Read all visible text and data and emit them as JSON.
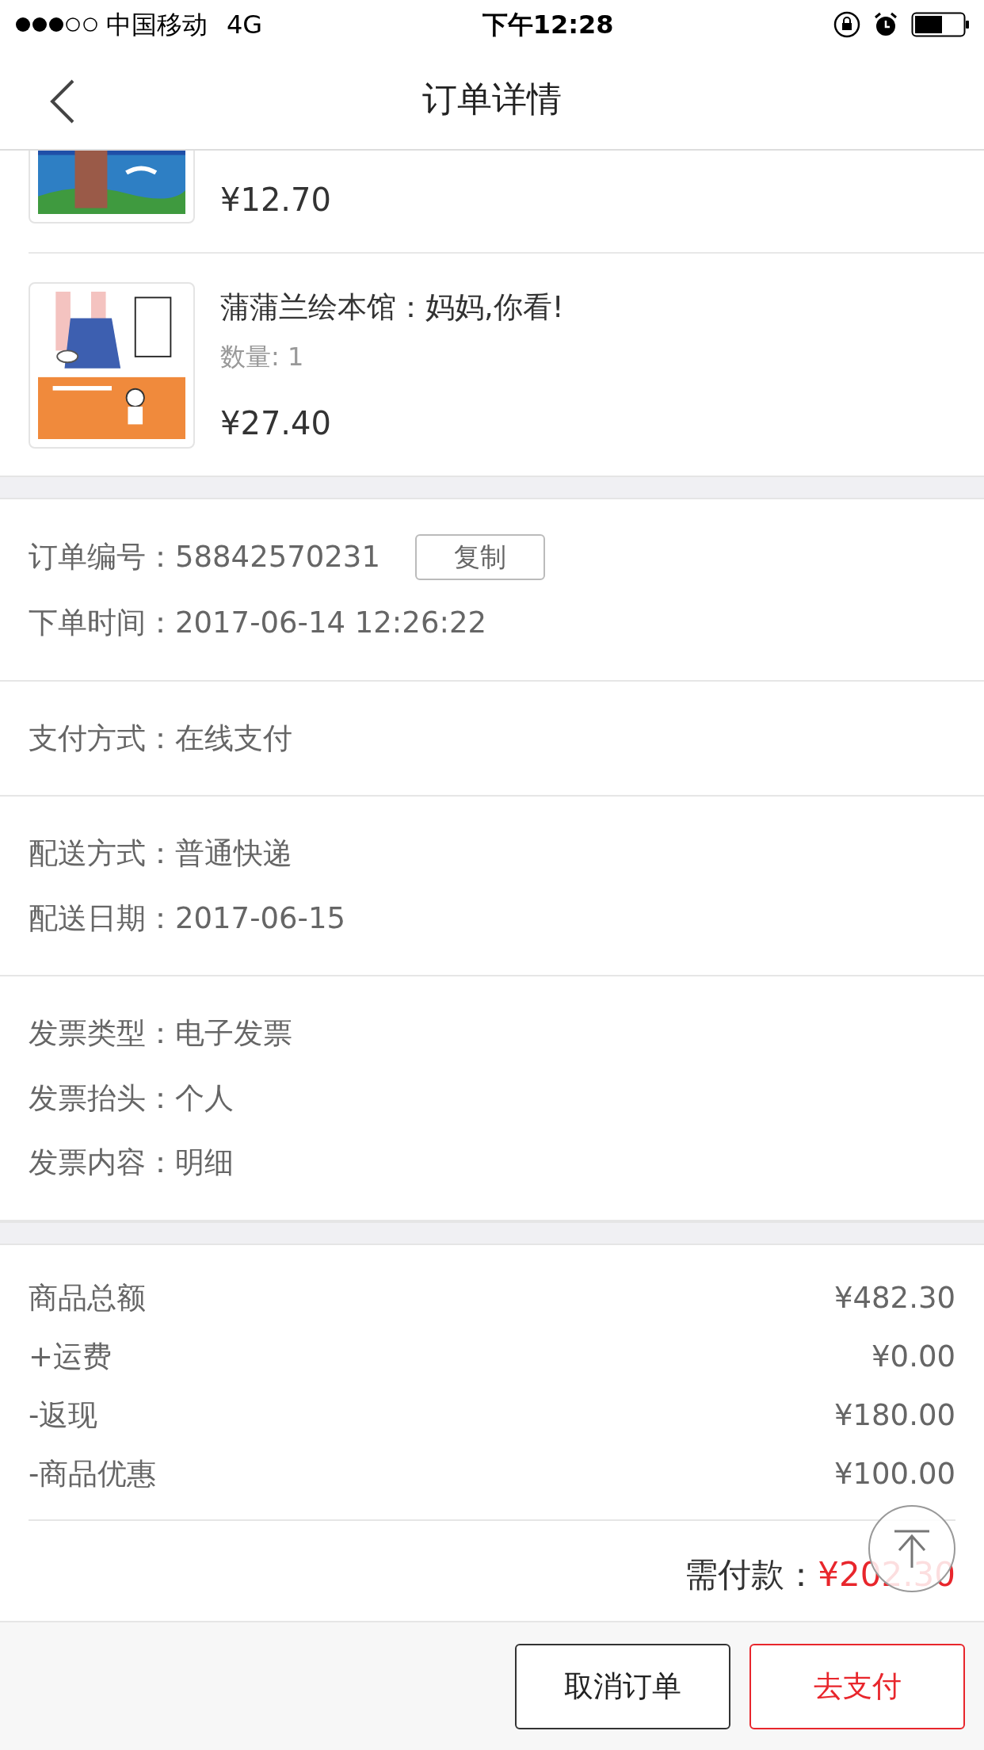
{
  "status_bar": {
    "carrier": "中国移动",
    "network": "4G",
    "time": "下午12:28"
  },
  "nav": {
    "title": "订单详情"
  },
  "products": [
    {
      "kind": "night",
      "price": "¥12.70"
    },
    {
      "kind": "kids",
      "title": "蒲蒲兰绘本馆：妈妈,你看!",
      "quantity": "数量: 1",
      "price": "¥27.40"
    }
  ],
  "order_info": [
    {
      "fields": [
        {
          "label": "订单编号：",
          "value": "58842570231",
          "action": "复制"
        },
        {
          "label": "下单时间：",
          "value": "2017-06-14 12:26:22"
        }
      ]
    },
    {
      "fields": [
        {
          "label": "支付方式：",
          "value": "在线支付"
        }
      ]
    },
    {
      "fields": [
        {
          "label": "配送方式：",
          "value": "普通快递"
        },
        {
          "label": "配送日期：",
          "value": "2017-06-15"
        }
      ]
    },
    {
      "fields": [
        {
          "label": "发票类型：",
          "value": "电子发票"
        },
        {
          "label": "发票抬头：",
          "value": "个人"
        },
        {
          "label": "发票内容：",
          "value": "明细"
        }
      ]
    }
  ],
  "summary": [
    {
      "label": "商品总额",
      "amount": "¥482.30"
    },
    {
      "label": "+运费",
      "amount": "¥0.00"
    },
    {
      "label": "-返现",
      "amount": "¥180.00"
    },
    {
      "label": "-商品优惠",
      "amount": "¥100.00"
    }
  ],
  "total": {
    "label": "需付款：",
    "amount": "¥202.30"
  },
  "buttons": [
    {
      "label": "取消订单",
      "kind": "secondary"
    },
    {
      "label": "去支付",
      "kind": "primary"
    }
  ]
}
